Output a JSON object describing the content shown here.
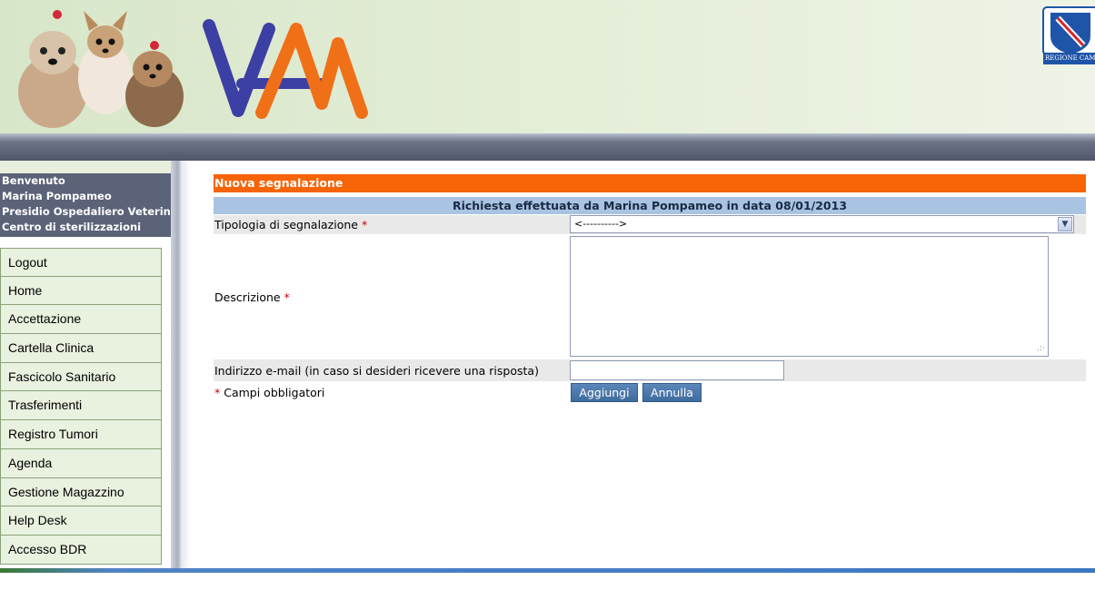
{
  "header": {
    "logo_text": "VAM",
    "crest_caption": "REGIONE CAMPANIA",
    "colors": {
      "vam_purple": "#3c3fa3",
      "vam_orange": "#f07018",
      "crest_blue": "#1f55a8"
    }
  },
  "sidebar": {
    "welcome": [
      "Benvenuto",
      "Marina Pompameo",
      "Presidio Ospedaliero Veterinario",
      "Centro di sterilizzazioni"
    ],
    "items": [
      {
        "label": "Logout"
      },
      {
        "label": "Home"
      },
      {
        "label": "Accettazione"
      },
      {
        "label": "Cartella Clinica"
      },
      {
        "label": "Fascicolo Sanitario"
      },
      {
        "label": "Trasferimenti"
      },
      {
        "label": "Registro Tumori"
      },
      {
        "label": "Agenda"
      },
      {
        "label": "Gestione Magazzino"
      },
      {
        "label": "Help Desk"
      },
      {
        "label": "Accesso BDR"
      }
    ]
  },
  "form": {
    "title": "Nuova segnalazione",
    "subtitle": "Richiesta effettuata da Marina Pompameo in data 08/01/2013",
    "tipologia_label": "Tipologia di segnalazione",
    "tipologia_selected": "<---------->",
    "descrizione_label": "Descrizione",
    "email_label": "Indirizzo e-mail (in caso si desideri ricevere una risposta)",
    "email_value": "",
    "required_marker": "*",
    "required_note": "Campi obbligatori",
    "add_label": "Aggiungi",
    "cancel_label": "Annulla",
    "colors": {
      "title_bg": "#f66405",
      "subtitle_bg": "#a9c4e2",
      "required": "#cc0000"
    }
  }
}
